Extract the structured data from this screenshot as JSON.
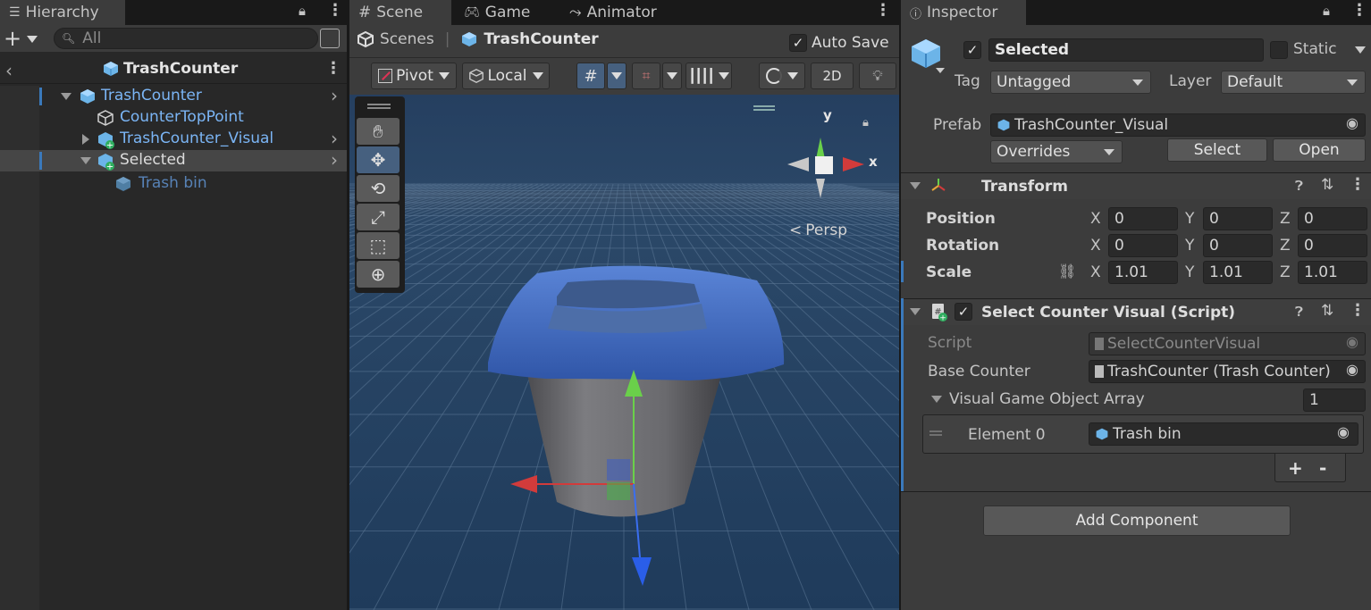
{
  "hierarchy": {
    "tab_label": "Hierarchy",
    "search_placeholder": "All",
    "scene_title": "TrashCounter",
    "items": [
      {
        "label": "TrashCounter"
      },
      {
        "label": "CounterTopPoint"
      },
      {
        "label": "TrashCounter_Visual"
      },
      {
        "label": "Selected"
      },
      {
        "label": "Trash bin"
      }
    ]
  },
  "scene": {
    "tabs": [
      {
        "label": "Scene"
      },
      {
        "label": "Game"
      },
      {
        "label": "Animator"
      }
    ],
    "breadcrumb": {
      "root": "Scenes",
      "current": "TrashCounter"
    },
    "auto_save_label": "Auto Save",
    "auto_save_checked": true,
    "toolbar": {
      "pivot": "Pivot",
      "local": "Local",
      "mode_2d": "2D"
    },
    "persp_label": "Persp",
    "gizmo": {
      "y": "y",
      "x": "x"
    }
  },
  "inspector": {
    "tab_label": "Inspector",
    "object_name": "Selected",
    "static_label": "Static",
    "tag_label": "Tag",
    "tag_value": "Untagged",
    "layer_label": "Layer",
    "layer_value": "Default",
    "prefab_label": "Prefab",
    "prefab_value": "TrashCounter_Visual",
    "overrides_label": "Overrides",
    "select_btn": "Select",
    "open_btn": "Open",
    "transform": {
      "title": "Transform",
      "position": {
        "label": "Position",
        "x": "0",
        "y": "0",
        "z": "0"
      },
      "rotation": {
        "label": "Rotation",
        "x": "0",
        "y": "0",
        "z": "0"
      },
      "scale": {
        "label": "Scale",
        "x": "1.01",
        "y": "1.01",
        "z": "1.01"
      },
      "axis": {
        "x": "X",
        "y": "Y",
        "z": "Z"
      }
    },
    "script_component": {
      "title": "Select Counter Visual (Script)",
      "script_label": "Script",
      "script_value": "SelectCounterVisual",
      "base_counter_label": "Base Counter",
      "base_counter_value": "TrashCounter (Trash Counter)",
      "array_label": "Visual Game Object Array",
      "array_size": "1",
      "element_label": "Element 0",
      "element_value": "Trash bin",
      "plus": "+",
      "minus": "-"
    },
    "add_component": "Add Component"
  },
  "colors": {
    "panel_bg": "#282828",
    "selected_row": "#464646",
    "link_blue": "#7bb5f5",
    "sky": "#253f60",
    "bin_blue": "#3e6bc4"
  }
}
